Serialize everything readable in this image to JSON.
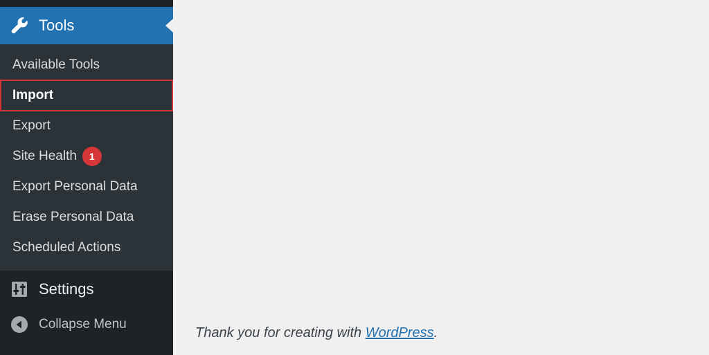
{
  "sidebar": {
    "active_menu": {
      "label": "Tools",
      "icon": "wrench-icon"
    },
    "submenu": [
      {
        "label": "Available Tools"
      },
      {
        "label": "Import"
      },
      {
        "label": "Export"
      },
      {
        "label": "Site Health",
        "badge": "1"
      },
      {
        "label": "Export Personal Data"
      },
      {
        "label": "Erase Personal Data"
      },
      {
        "label": "Scheduled Actions"
      }
    ],
    "settings": {
      "label": "Settings",
      "icon": "settings-sliders-icon"
    },
    "collapse": {
      "label": "Collapse Menu",
      "icon": "collapse-arrow-icon"
    }
  },
  "footer": {
    "text_before": "Thank you for creating with ",
    "link_text": "WordPress",
    "text_after": "."
  },
  "colors": {
    "sidebar_bg": "#1d2327",
    "submenu_bg": "#2c3338",
    "accent_blue": "#2271b1",
    "highlight_red": "#d63638",
    "content_bg": "#f0f0f1"
  }
}
